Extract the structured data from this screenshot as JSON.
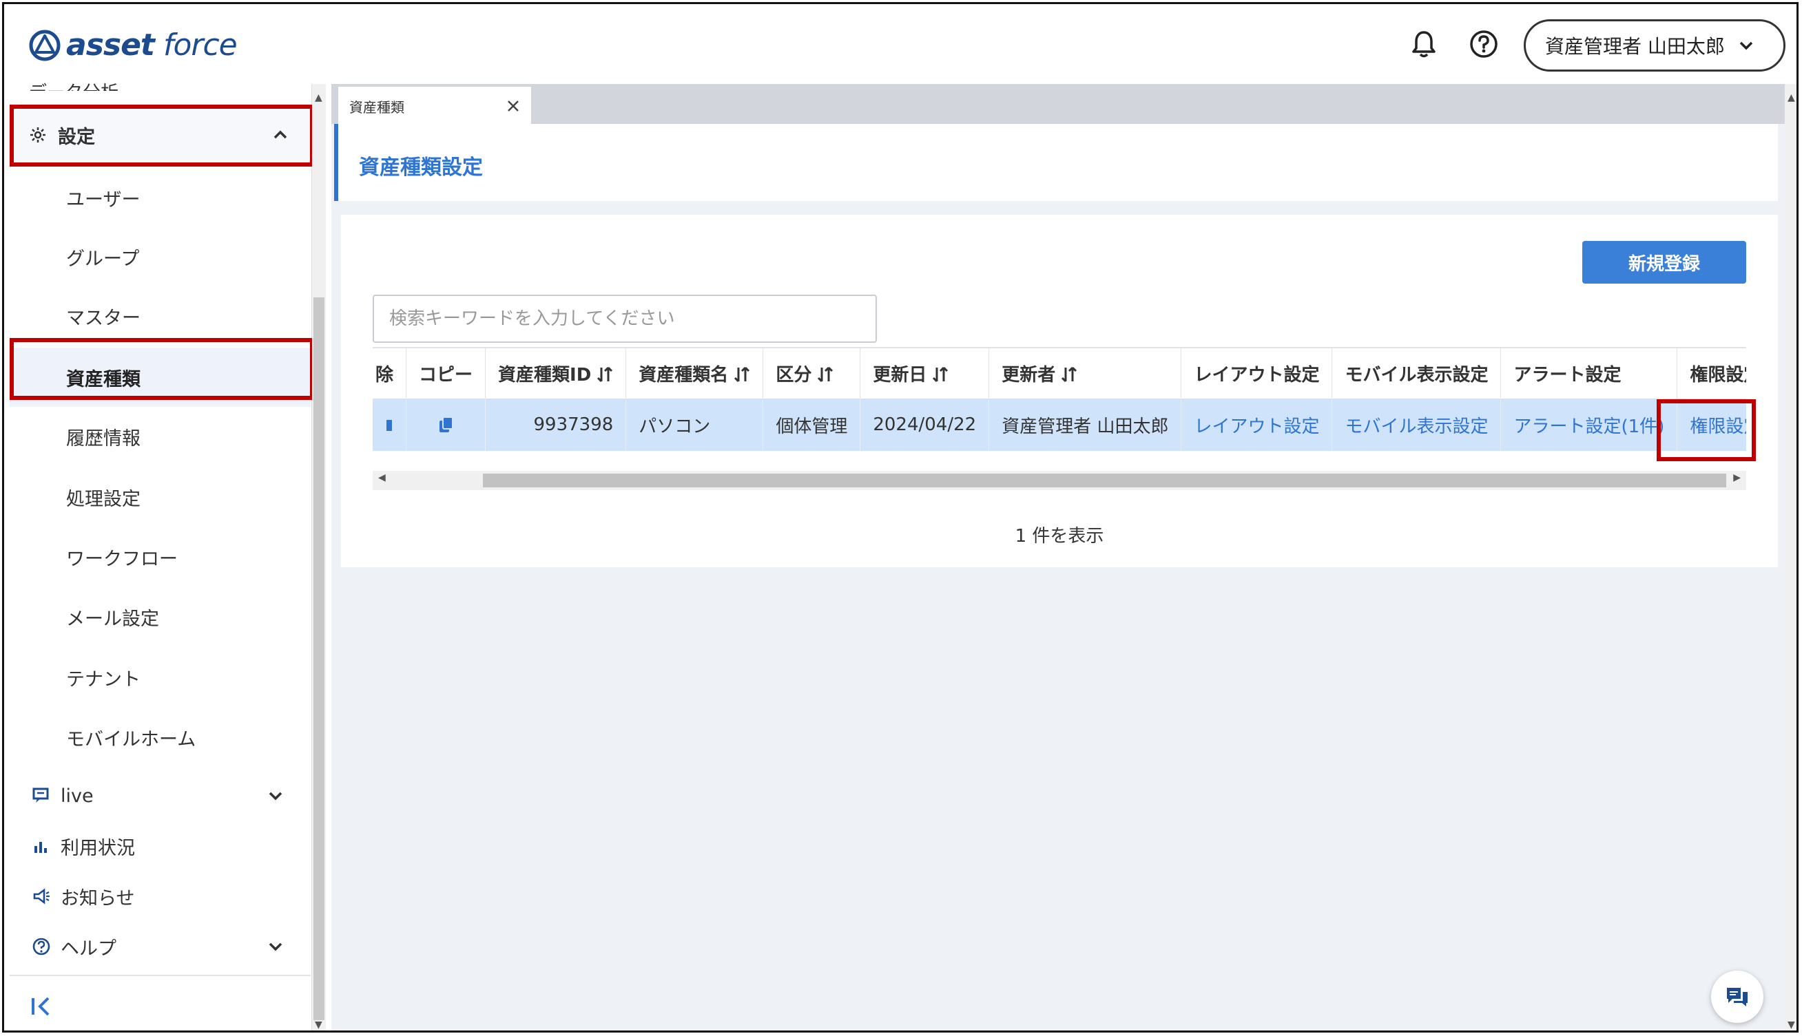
{
  "header": {
    "logo_asset": "asset",
    "logo_force": "force",
    "user_label": "資産管理者 山田太郎"
  },
  "sidebar": {
    "cut_item": "データ分析",
    "settings_label": "設定",
    "sub_items": [
      "ユーザー",
      "グループ",
      "マスター",
      "資産種類",
      "履歴情報",
      "処理設定",
      "ワークフロー",
      "メール設定",
      "テナント",
      "モバイルホーム"
    ],
    "active_sub_item": "資産種類",
    "items": [
      {
        "label": "live",
        "icon": "live-icon",
        "expandable": true
      },
      {
        "label": "利用状況",
        "icon": "bar-chart-icon",
        "expandable": false
      },
      {
        "label": "お知らせ",
        "icon": "megaphone-icon",
        "expandable": false
      },
      {
        "label": "ヘルプ",
        "icon": "help-circle-icon",
        "expandable": true
      }
    ]
  },
  "tabs": [
    {
      "label": "資産種類"
    }
  ],
  "page": {
    "title": "資産種類設定",
    "new_button": "新規登録",
    "search_placeholder": "検索キーワードを入力してください",
    "count_text": "1 件を表示"
  },
  "table": {
    "headers": [
      "除",
      "コピー",
      "資産種類ID",
      "資産種類名",
      "区分",
      "更新日",
      "更新者",
      "レイアウト設定",
      "モバイル表示設定",
      "アラート設定",
      "権限設定"
    ],
    "rows": [
      {
        "id": "9937398",
        "name": "パソコン",
        "category": "個体管理",
        "updated": "2024/04/22",
        "updater": "資産管理者 山田太郎",
        "layout": "レイアウト設定",
        "mobile": "モバイル表示設定",
        "alert": "アラート設定(1件)",
        "permission": "権限設定"
      }
    ]
  },
  "colors": {
    "accent": "#2f74d0",
    "highlight_box": "#c00000",
    "selected_row": "#cfe3fa",
    "logo": "#1d4b8f"
  }
}
